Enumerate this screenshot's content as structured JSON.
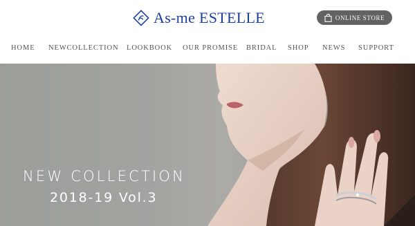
{
  "header": {
    "logo_text": "As-me ESTELLE",
    "online_store_label": "ONLINE STORE"
  },
  "nav": {
    "items": [
      {
        "label": "HOME"
      },
      {
        "label": "NEWCOLLECTION"
      },
      {
        "label": "LOOKBOOK"
      },
      {
        "label": "OUR PROMISE"
      },
      {
        "label": "BRIDAL"
      },
      {
        "label": "SHOP"
      },
      {
        "label": "NEWS"
      },
      {
        "label": "SUPPORT"
      }
    ]
  },
  "hero": {
    "title": "NEW COLLECTION",
    "subtitle": "2018-19 Vol.3"
  },
  "colors": {
    "brand_blue": "#1d3f9c",
    "store_button": "#626262",
    "nav_text": "#555555",
    "hero_background": "#a7a8a4"
  },
  "icons": {
    "logo": "logo-mark-icon",
    "store": "shopping-bag-icon"
  }
}
